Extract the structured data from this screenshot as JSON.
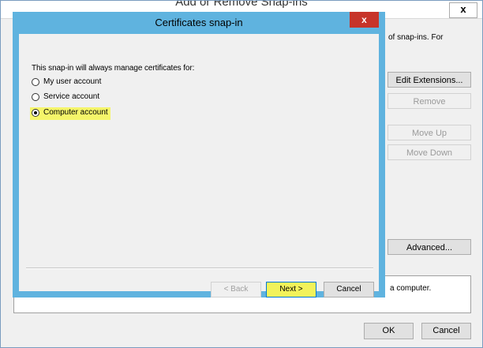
{
  "back_window": {
    "title": "Add or Remove Snap-ins",
    "close_label": "x",
    "description_fragment": "of snap-ins. For",
    "buttons": {
      "edit_extensions": "Edit Extensions...",
      "remove": "Remove",
      "move_up": "Move Up",
      "move_down": "Move Down",
      "advanced": "Advanced..."
    },
    "description_box_text": "a computer.",
    "ok": "OK",
    "cancel": "Cancel"
  },
  "snapin_dialog": {
    "title": "Certificates snap-in",
    "close_label": "x",
    "prompt": "This snap-in will always manage certificates for:",
    "options": [
      {
        "label": "My user account",
        "selected": false
      },
      {
        "label": "Service account",
        "selected": false
      },
      {
        "label": "Computer account",
        "selected": true
      }
    ],
    "buttons": {
      "back": "< Back",
      "next": "Next >",
      "cancel": "Cancel"
    }
  },
  "colors": {
    "dialog_frame": "#5fb3df",
    "close_button": "#c7342a",
    "highlight": "#f5f56a"
  }
}
